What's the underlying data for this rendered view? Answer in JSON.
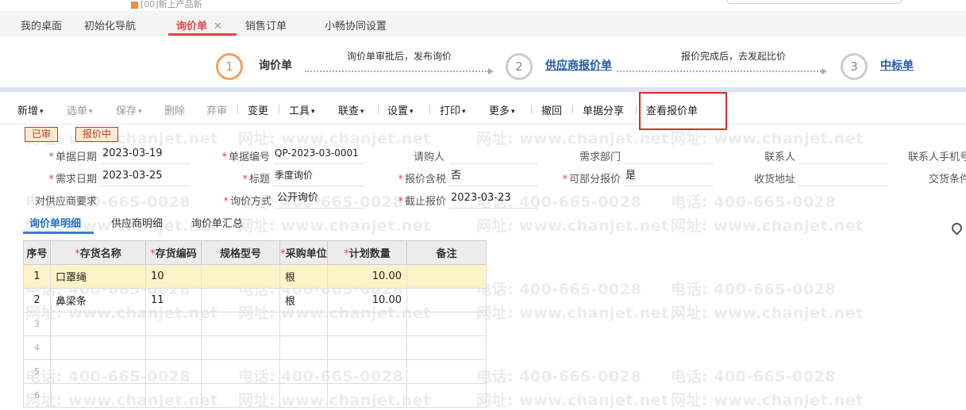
{
  "header": {
    "crumb": "[00]新上产品新"
  },
  "tabs": [
    {
      "label": "我的桌面"
    },
    {
      "label": "初始化导航"
    },
    {
      "label": "询价单",
      "close": "✕"
    },
    {
      "label": "销售订单"
    },
    {
      "label": "小畅协同设置"
    }
  ],
  "steps": [
    {
      "num": "1",
      "label": "询价单"
    },
    {
      "num": "2",
      "label": "供应商报价单"
    },
    {
      "num": "3",
      "label": "中标单"
    }
  ],
  "step_notes": [
    "询价单审批后，发布询价",
    "报价完成后，去发起比价"
  ],
  "toolbar": [
    {
      "label": "新增",
      "caret": "▾"
    },
    {
      "label": "选单",
      "caret": "▾"
    },
    {
      "label": "保存",
      "caret": "▾"
    },
    {
      "label": "删除"
    },
    {
      "label": "弃审"
    },
    {
      "label": "变更"
    },
    {
      "label": "工具",
      "caret": "▾"
    },
    {
      "label": "联查",
      "caret": "▾"
    },
    {
      "label": "设置",
      "caret": "▾"
    },
    {
      "label": "打印",
      "caret": "▾"
    },
    {
      "label": "更多",
      "caret": "▾"
    },
    {
      "label": "撤回"
    },
    {
      "label": "单据分享"
    },
    {
      "label": "查看报价单"
    }
  ],
  "badges": [
    "已审",
    "报价中"
  ],
  "form": {
    "req_mark": "*",
    "bill_date": {
      "label": "单据日期",
      "value": "2023-03-19"
    },
    "bill_no": {
      "label": "单据编号",
      "value": "QP-2023-03-0001"
    },
    "buyer": {
      "label": "请购人",
      "value": ""
    },
    "dept": {
      "label": "需求部门",
      "value": ""
    },
    "contact": {
      "label": "联系人",
      "value": ""
    },
    "contact_phone": {
      "label": "联系人手机号"
    },
    "need_date": {
      "label": "需求日期",
      "value": "2023-03-25"
    },
    "title": {
      "label": "标题",
      "value": "季度询价"
    },
    "tax": {
      "label": "报价含税",
      "value": "否"
    },
    "partial": {
      "label": "可部分报价",
      "value": "是"
    },
    "address": {
      "label": "收货地址",
      "value": ""
    },
    "terms": {
      "label": "交货条件"
    },
    "supplier_req": {
      "label": "对供应商要求",
      "value": ""
    },
    "method": {
      "label": "询价方式",
      "value": "公开询价"
    },
    "deadline": {
      "label": "截止报价",
      "value": "2023-03-23"
    }
  },
  "subtabs": [
    "询价单明细",
    "供应商明细",
    "询价单汇总"
  ],
  "table": {
    "headers": [
      "序号",
      "存货名称",
      "存货编码",
      "规格型号",
      "采购单位",
      "计划数量",
      "备注"
    ],
    "rows": [
      {
        "idx": "1",
        "name": "口罩绳",
        "code": "10",
        "spec": "",
        "unit": "根",
        "qty": "10.00",
        "note": ""
      },
      {
        "idx": "2",
        "name": "鼻梁条",
        "code": "11",
        "spec": "",
        "unit": "根",
        "qty": "10.00",
        "note": ""
      },
      {
        "idx": "3"
      },
      {
        "idx": "4"
      },
      {
        "idx": "5"
      },
      {
        "idx": "6"
      }
    ]
  },
  "watermark": {
    "phone": "电话: 400-665-0028",
    "site": "网址: www.chanjet.net"
  }
}
